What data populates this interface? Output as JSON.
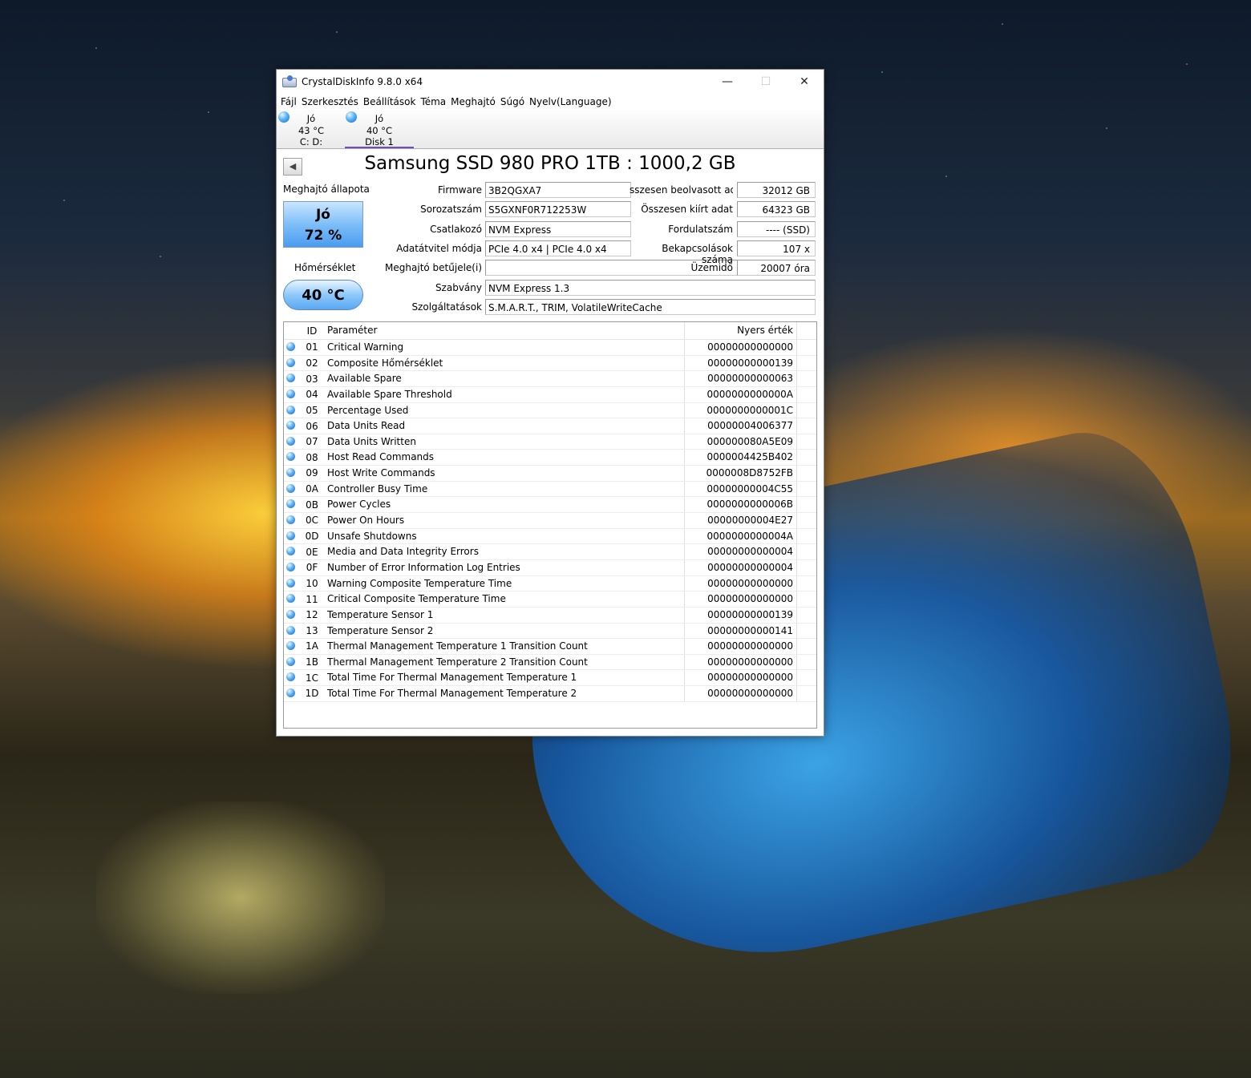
{
  "window": {
    "title": "CrystalDiskInfo 9.8.0 x64"
  },
  "controls": {
    "minimize": "—",
    "maximize": "☐",
    "close": "✕"
  },
  "menu": [
    "Fájl",
    "Szerkesztés",
    "Beállítások",
    "Téma",
    "Meghajtó",
    "Súgó",
    "Nyelv(Language)"
  ],
  "tabs": [
    {
      "status": "Jó",
      "temp": "43 °C",
      "name": "C: D:"
    },
    {
      "status": "Jó",
      "temp": "40 °C",
      "name": "Disk 1"
    }
  ],
  "model": "Samsung SSD 980 PRO 1TB : 1000,2 GB",
  "health": {
    "label": "Meghajtó állapota",
    "status": "Jó",
    "percent": "72 %"
  },
  "temperature": {
    "label": "Hőmérséklet",
    "value": "40 °C"
  },
  "left_fields": [
    {
      "label": "Firmware",
      "value": "3B2QGXA7"
    },
    {
      "label": "Sorozatszám",
      "value": "S5GXNF0R712253W"
    },
    {
      "label": "Csatlakozó",
      "value": "NVM Express"
    },
    {
      "label": "Adatátvitel módja",
      "value": "PCIe 4.0 x4 | PCIe 4.0 x4"
    },
    {
      "label": "Meghajtó betűjele(i)",
      "value": ""
    },
    {
      "label": "Szabvány",
      "value": "NVM Express 1.3"
    },
    {
      "label": "Szolgáltatások",
      "value": "S.M.A.R.T., TRIM, VolatileWriteCache"
    }
  ],
  "right_fields": [
    {
      "label": "sszesen beolvasott adat",
      "value": "32012 GB"
    },
    {
      "label": "Összesen kiírt adat",
      "value": "64323 GB"
    },
    {
      "label": "Fordulatszám",
      "value": "---- (SSD)"
    },
    {
      "label": "Bekapcsolások száma",
      "value": "107 x"
    },
    {
      "label": "Üzemidő",
      "value": "20007 óra"
    }
  ],
  "smart": {
    "headers": {
      "id": "ID",
      "param": "Paraméter",
      "raw": "Nyers érték"
    },
    "rows": [
      {
        "id": "01",
        "param": "Critical Warning",
        "raw": "00000000000000"
      },
      {
        "id": "02",
        "param": "Composite Hőmérséklet",
        "raw": "00000000000139"
      },
      {
        "id": "03",
        "param": "Available Spare",
        "raw": "00000000000063"
      },
      {
        "id": "04",
        "param": "Available Spare Threshold",
        "raw": "0000000000000A"
      },
      {
        "id": "05",
        "param": "Percentage Used",
        "raw": "0000000000001C"
      },
      {
        "id": "06",
        "param": "Data Units Read",
        "raw": "00000004006377"
      },
      {
        "id": "07",
        "param": "Data Units Written",
        "raw": "000000080A5E09"
      },
      {
        "id": "08",
        "param": "Host Read Commands",
        "raw": "0000004425B402"
      },
      {
        "id": "09",
        "param": "Host Write Commands",
        "raw": "0000008D8752FB"
      },
      {
        "id": "0A",
        "param": "Controller Busy Time",
        "raw": "00000000004C55"
      },
      {
        "id": "0B",
        "param": "Power Cycles",
        "raw": "0000000000006B"
      },
      {
        "id": "0C",
        "param": "Power On Hours",
        "raw": "00000000004E27"
      },
      {
        "id": "0D",
        "param": "Unsafe Shutdowns",
        "raw": "0000000000004A"
      },
      {
        "id": "0E",
        "param": "Media and Data Integrity Errors",
        "raw": "00000000000004"
      },
      {
        "id": "0F",
        "param": "Number of Error Information Log Entries",
        "raw": "00000000000004"
      },
      {
        "id": "10",
        "param": "Warning Composite Temperature Time",
        "raw": "00000000000000"
      },
      {
        "id": "11",
        "param": "Critical Composite Temperature Time",
        "raw": "00000000000000"
      },
      {
        "id": "12",
        "param": "Temperature Sensor 1",
        "raw": "00000000000139"
      },
      {
        "id": "13",
        "param": "Temperature Sensor 2",
        "raw": "00000000000141"
      },
      {
        "id": "1A",
        "param": "Thermal Management Temperature 1 Transition Count",
        "raw": "00000000000000"
      },
      {
        "id": "1B",
        "param": "Thermal Management Temperature 2 Transition Count",
        "raw": "00000000000000"
      },
      {
        "id": "1C",
        "param": "Total Time For Thermal Management Temperature 1",
        "raw": "00000000000000"
      },
      {
        "id": "1D",
        "param": "Total Time For Thermal Management Temperature 2",
        "raw": "00000000000000"
      }
    ]
  },
  "colors": {
    "accent": "#6a4aca",
    "health_blue": "#4a9cf0"
  }
}
